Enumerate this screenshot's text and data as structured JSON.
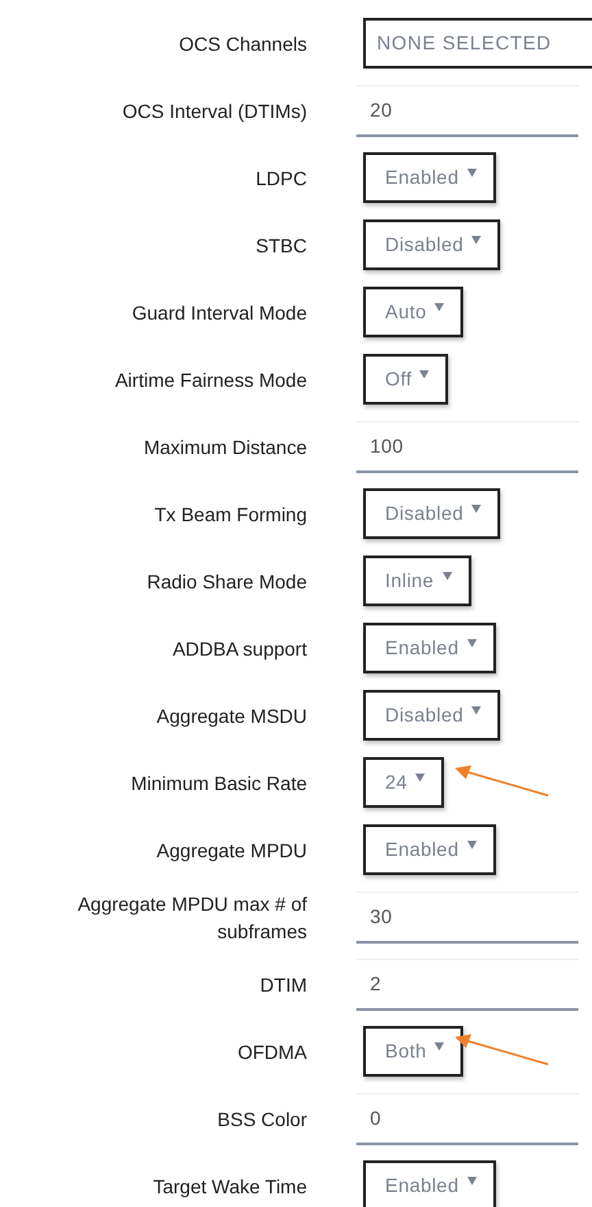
{
  "settings": [
    {
      "label": "OCS Channels",
      "kind": "multiselect",
      "value": "NONE SELECTED",
      "annotated": false
    },
    {
      "label": "OCS Interval (DTIMs)",
      "kind": "input",
      "value": "20",
      "annotated": false
    },
    {
      "label": "LDPC",
      "kind": "select",
      "value": "Enabled",
      "annotated": false
    },
    {
      "label": "STBC",
      "kind": "select",
      "value": "Disabled",
      "annotated": false
    },
    {
      "label": "Guard Interval Mode",
      "kind": "select",
      "value": "Auto",
      "annotated": false
    },
    {
      "label": "Airtime Fairness Mode",
      "kind": "select",
      "value": "Off",
      "annotated": false
    },
    {
      "label": "Maximum Distance",
      "kind": "input",
      "value": "100",
      "annotated": false
    },
    {
      "label": "Tx Beam Forming",
      "kind": "select",
      "value": "Disabled",
      "annotated": false
    },
    {
      "label": "Radio Share Mode",
      "kind": "select",
      "value": "Inline",
      "annotated": false
    },
    {
      "label": "ADDBA support",
      "kind": "select",
      "value": "Enabled",
      "annotated": false
    },
    {
      "label": "Aggregate MSDU",
      "kind": "select",
      "value": "Disabled",
      "annotated": false
    },
    {
      "label": "Minimum Basic Rate",
      "kind": "select",
      "value": "24",
      "annotated": true
    },
    {
      "label": "Aggregate MPDU",
      "kind": "select",
      "value": "Enabled",
      "annotated": false
    },
    {
      "label": "Aggregate MPDU max # of subframes",
      "kind": "input",
      "value": "30",
      "annotated": false
    },
    {
      "label": "DTIM",
      "kind": "input",
      "value": "2",
      "annotated": false
    },
    {
      "label": "OFDMA",
      "kind": "select",
      "value": "Both",
      "annotated": true
    },
    {
      "label": "BSS Color",
      "kind": "input",
      "value": "0",
      "annotated": false
    },
    {
      "label": "Target Wake Time",
      "kind": "select",
      "value": "Enabled",
      "annotated": false
    }
  ]
}
